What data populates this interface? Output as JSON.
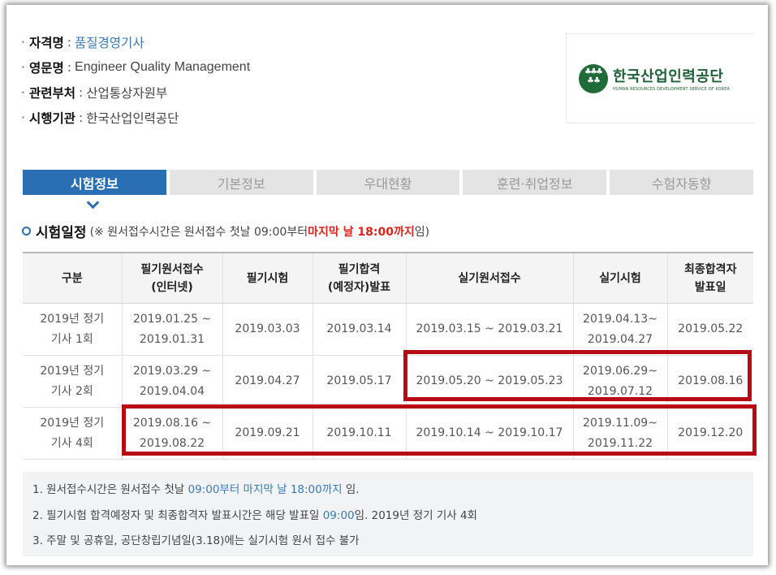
{
  "info": {
    "rows": [
      {
        "label": "자격명",
        "sep": ":",
        "value": "품질경영기사"
      },
      {
        "label": "영문명",
        "sep": ":",
        "value": "Engineer Quality Management"
      },
      {
        "label": "관련부처",
        "sep": ":",
        "value": "산업통상자원부"
      },
      {
        "label": "시행기관",
        "sep": ":",
        "value": "한국산업인력공단"
      }
    ]
  },
  "logo": {
    "name_ko": "한국산업인력공단",
    "name_en": "HUMAN RESOURCES DEVELOPMENT SERVICE OF KOREA"
  },
  "tabs": [
    "시험정보",
    "기본정보",
    "우대현황",
    "훈련·취업정보",
    "수험자동향"
  ],
  "schedule": {
    "title": "시험일정",
    "note_prefix": "(※ 원서접수시간은 원서접수 첫날 09:00부터 ",
    "note_red": "마지막 날 18:00까지",
    "note_suffix": "임)",
    "headers": [
      [
        "구분"
      ],
      [
        "필기원서접수",
        "(인터넷)"
      ],
      [
        "필기시험"
      ],
      [
        "필기합격",
        "(예정자)발표"
      ],
      [
        "실기원서접수"
      ],
      [
        "실기시험"
      ],
      [
        "최종합격자",
        "발표일"
      ]
    ],
    "rows": [
      [
        [
          "2019년 정기",
          "기사 1회"
        ],
        [
          "2019.01.25 ~",
          "2019.01.31"
        ],
        [
          "2019.03.03"
        ],
        [
          "2019.03.14"
        ],
        [
          "2019.03.15 ~ 2019.03.21"
        ],
        [
          "2019.04.13~",
          "2019.04.27"
        ],
        [
          "2019.05.22"
        ]
      ],
      [
        [
          "2019년 정기",
          "기사 2회"
        ],
        [
          "2019.03.29 ~",
          "2019.04.04"
        ],
        [
          "2019.04.27"
        ],
        [
          "2019.05.17"
        ],
        [
          "2019.05.20 ~ 2019.05.23"
        ],
        [
          "2019.06.29~",
          "2019.07.12"
        ],
        [
          "2019.08.16"
        ]
      ],
      [
        [
          "2019년 정기",
          "기사 4회"
        ],
        [
          "2019.08.16 ~",
          "2019.08.22"
        ],
        [
          "2019.09.21"
        ],
        [
          "2019.10.11"
        ],
        [
          "2019.10.14 ~ 2019.10.17"
        ],
        [
          "2019.11.09~",
          "2019.11.22"
        ],
        [
          "2019.12.20"
        ]
      ]
    ]
  },
  "notes": {
    "n1": {
      "a": "1. 원서접수시간은 원서접수 첫날 ",
      "b": "09:00부터 마지막 날 18:00까지",
      "c": " 임."
    },
    "n2": {
      "a": "2. 필기시험 합격예정자 및 최종합격자 발표시간은 해당 발표일 ",
      "b": "09:00",
      "c": "임. 2019년 정기 기사 4회"
    },
    "n3": "3. 주말 및 공휴일, 공단창립기념일(3.18)에는 실기시험 원서 접수 불가"
  },
  "colors": {
    "tab_active": "#2a6fb3",
    "highlight": "#b70a13",
    "red_text": "#e0221a",
    "link_blue": "#3a79b8",
    "logo_green": "#1f6b39"
  }
}
